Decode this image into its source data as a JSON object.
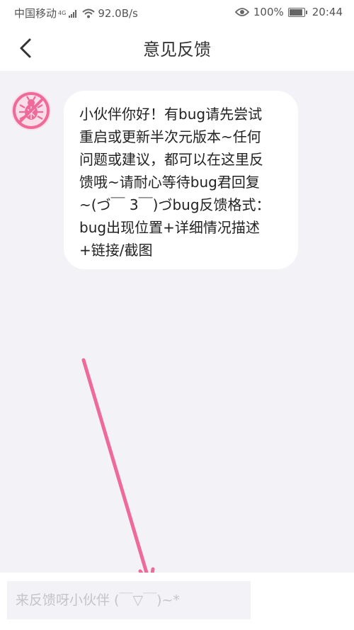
{
  "status_bar": {
    "carrier": "中国移动",
    "network": "4G",
    "speed": "92.0B/s",
    "battery": "100%",
    "battery_level": 1.0,
    "time": "20:44"
  },
  "nav": {
    "back_icon": "chevron-left-icon",
    "title": "意见反馈"
  },
  "chat": {
    "avatar_icon": "bug-icon",
    "message": "小伙伴你好！有bug请先尝试\n重启或更新半次元版本~任何\n问题或建议，都可以在这里反\n馈哦~请耐心等待bug君回复\n~(づ￣ 3￣)づbug反馈格式：\nbug出现位置+详细情况描述\n+链接/截图"
  },
  "input": {
    "placeholder": "来反馈呀小伙伴 (￣▽￣)~*",
    "value": ""
  },
  "colors": {
    "background": "#f3f2f7",
    "accent_pink": "#ee6a98",
    "avatar_bg": "#f9dde7",
    "bubble": "#ffffff"
  }
}
